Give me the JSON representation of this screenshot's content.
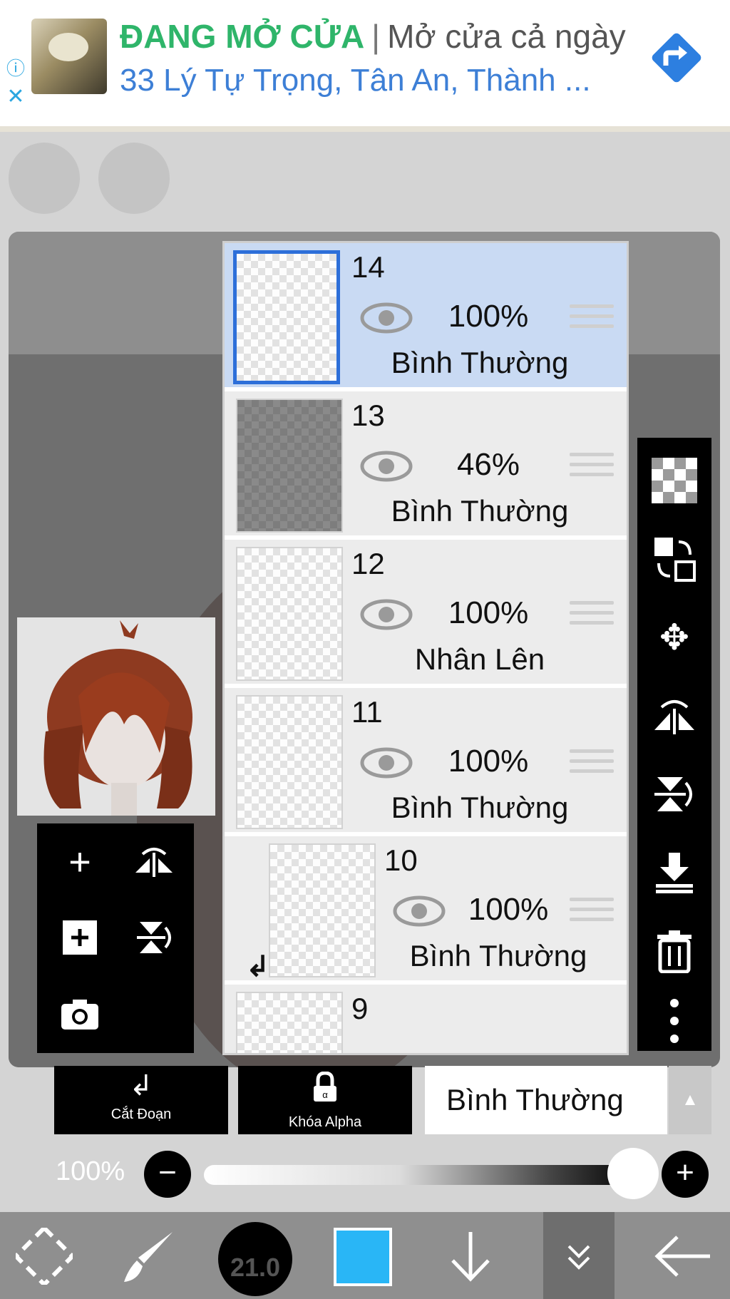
{
  "ad": {
    "status": "ĐANG MỞ CỬA",
    "separator": "|",
    "hours": "Mở cửa cả ngày",
    "address": "33 Lý Tự Trọng, Tân An, Thành ...",
    "info_icon": "info-icon",
    "close_icon": "close-icon",
    "directions_icon": "directions-icon",
    "status_color": "#2fb56a",
    "address_color": "#3d7fd6",
    "directions_color": "#2d7fe0"
  },
  "layers": [
    {
      "number": "14",
      "opacity": "100%",
      "blend": "Bình Thường",
      "selected": true
    },
    {
      "number": "13",
      "opacity": "46%",
      "blend": "Bình Thường",
      "selected": false
    },
    {
      "number": "12",
      "opacity": "100%",
      "blend": "Nhân Lên",
      "selected": false
    },
    {
      "number": "11",
      "opacity": "100%",
      "blend": "Bình Thường",
      "selected": false
    },
    {
      "number": "10",
      "opacity": "100%",
      "blend": "Bình Thường",
      "selected": false
    },
    {
      "number": "9"
    }
  ],
  "right_toolbar": [
    "transparency-icon",
    "layer-swap-icon",
    "move-icon",
    "flip-horizontal-icon",
    "flip-vertical-icon",
    "merge-down-icon",
    "trash-icon",
    "more-icon"
  ],
  "left_toolbar": [
    "add-layer-icon",
    "flip-horizontal-icon",
    "add-fill-layer-icon",
    "flip-vertical-icon",
    "camera-icon"
  ],
  "controls": {
    "clipping_label": "Cắt Đoạn",
    "alpha_lock_label": "Khóa Alpha",
    "blend_mode": "Bình Thường",
    "opacity_label": "100%",
    "opacity_value": 1.0,
    "minus": "−",
    "plus": "+"
  },
  "bottom_bar": {
    "brush_size": "21.0",
    "color": "#29b6f6",
    "icons": [
      "transform-icon",
      "brush-icon",
      "brush-size-icon",
      "color-icon",
      "download-icon",
      "layers-collapse-icon",
      "back-icon"
    ]
  }
}
